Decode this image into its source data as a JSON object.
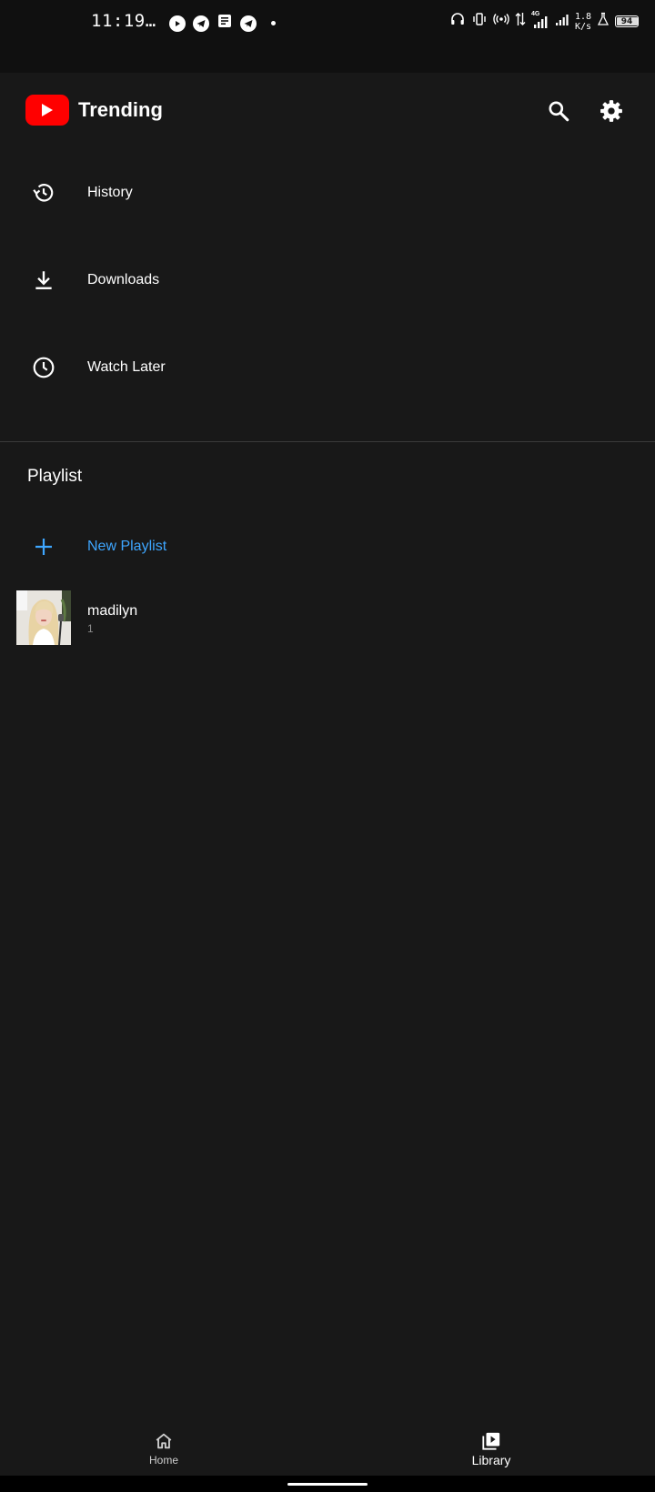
{
  "status_bar": {
    "time": "11:19…",
    "net_speed_value": "1.8",
    "net_speed_unit": "K/s",
    "signal_type": "4G",
    "battery_level": "94",
    "battery_fraction": 0.94
  },
  "app_bar": {
    "title": "Trending",
    "logo_icon": "youtube-logo",
    "accent_color": "#ff0000"
  },
  "menu": {
    "items": [
      {
        "label": "History",
        "icon": "history-icon"
      },
      {
        "label": "Downloads",
        "icon": "download-icon"
      },
      {
        "label": "Watch Later",
        "icon": "clock-icon"
      }
    ]
  },
  "playlist_section": {
    "title": "Playlist",
    "new_playlist_label": "New Playlist",
    "new_playlist_color": "#3ea6ff",
    "playlists": [
      {
        "name": "madilyn",
        "count": "1"
      }
    ]
  },
  "bottom_nav": {
    "home_label": "Home",
    "library_label": "Library",
    "active": "Library"
  }
}
